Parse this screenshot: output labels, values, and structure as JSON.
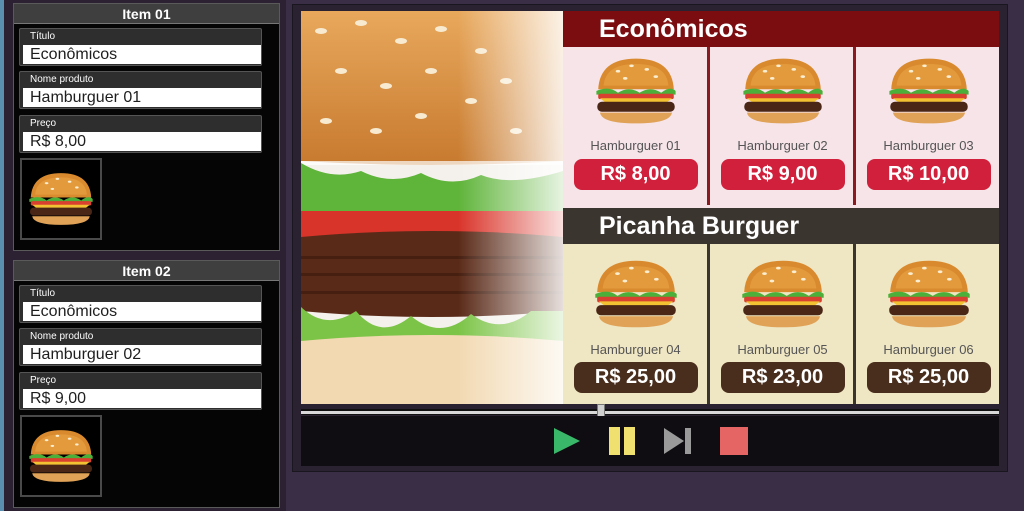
{
  "items": [
    {
      "header": "Item 01",
      "titulo_label": "Título",
      "titulo_value": "Econômicos",
      "nome_label": "Nome produto",
      "nome_value": "Hamburguer 01",
      "preco_label": "Preço",
      "preco_value": "R$ 8,00"
    },
    {
      "header": "Item 02",
      "titulo_label": "Título",
      "titulo_value": "Econômicos",
      "nome_label": "Nome produto",
      "nome_value": "Hamburguer 02",
      "preco_label": "Preço",
      "preco_value": "R$ 9,00"
    }
  ],
  "menu": {
    "sections": [
      {
        "title": "Econômicos",
        "band_color": "#7b0c10",
        "price_color": "#d0203b",
        "products": [
          {
            "name": "Hamburguer 01",
            "price": "R$ 8,00"
          },
          {
            "name": "Hamburguer 02",
            "price": "R$ 9,00"
          },
          {
            "name": "Hamburguer 03",
            "price": "R$ 10,00"
          }
        ]
      },
      {
        "title": "Picanha Burguer",
        "band_color": "#3b3530",
        "price_color": "#4a2e1d",
        "products": [
          {
            "name": "Hamburguer 04",
            "price": "R$ 25,00"
          },
          {
            "name": "Hamburguer 05",
            "price": "R$ 23,00"
          },
          {
            "name": "Hamburguer 06",
            "price": "R$ 25,00"
          }
        ]
      }
    ]
  },
  "player": {
    "progress_fraction": 0.43,
    "controls": [
      {
        "icon": "play-icon",
        "color": "#3ab86a"
      },
      {
        "icon": "pause-icon",
        "color": "#f0e070"
      },
      {
        "icon": "skip-next-icon",
        "color": "#9a9a9a"
      },
      {
        "icon": "stop-icon",
        "color": "#e56565"
      }
    ]
  }
}
